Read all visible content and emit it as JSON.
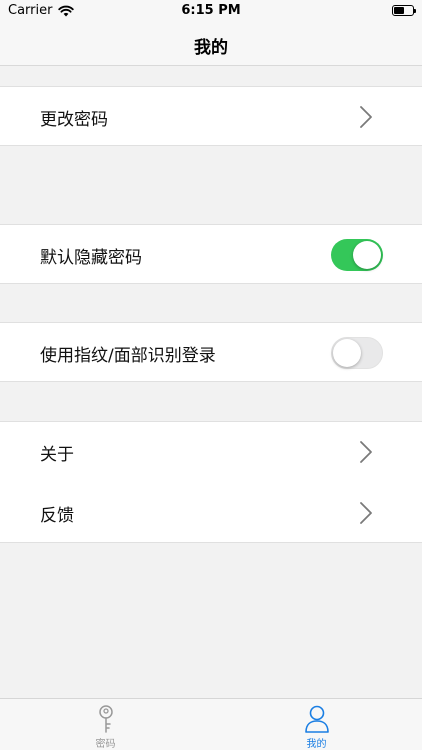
{
  "status_bar": {
    "carrier": "Carrier",
    "time": "6:15 PM",
    "wifi_icon": "wifi-icon",
    "battery_icon": "battery-icon",
    "battery_level": 0.55
  },
  "nav": {
    "title": "我的"
  },
  "settings": {
    "change_password": "更改密码",
    "hide_password_default": "默认隐藏密码",
    "hide_password_default_on": true,
    "biometric_login": "使用指纹/面部识别登录",
    "biometric_login_on": false,
    "about": "关于",
    "feedback": "反馈"
  },
  "tab_bar": {
    "tabs": [
      {
        "label": "密码",
        "icon": "key-icon",
        "selected": false
      },
      {
        "label": "我的",
        "icon": "person-icon",
        "selected": true
      }
    ]
  },
  "colors": {
    "accent": "#1a7ee3",
    "toggle_on": "#34c759",
    "toggle_off": "#e9e9ea",
    "tab_inactive": "#999999",
    "chevron": "#7a7a7a"
  }
}
